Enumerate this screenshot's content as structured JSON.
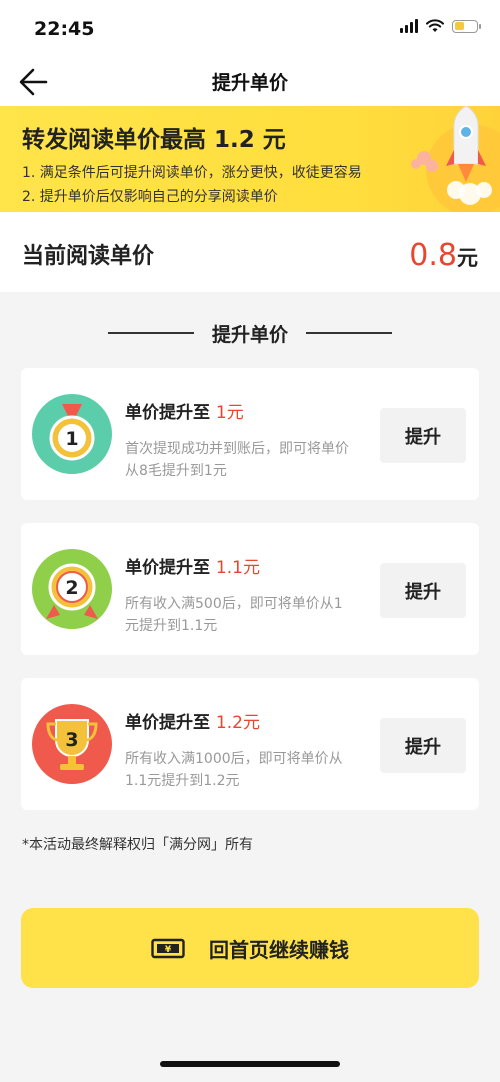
{
  "status_bar": {
    "time": "22:45"
  },
  "nav": {
    "title": "提升单价"
  },
  "banner": {
    "title": "转发阅读单价最高 1.2 元",
    "line1": "1. 满足条件后可提升阅读单价，涨分更快，收徒更容易",
    "line2": "2. 提升单价后仅影响自己的分享阅读单价"
  },
  "current_rate": {
    "label": "当前阅读单价",
    "value": "0.8",
    "unit": "元"
  },
  "section": {
    "title": "提升单价"
  },
  "tiers": [
    {
      "title_prefix": "单价提升至 ",
      "amount": "1元",
      "desc": "首次提现成功并到账后，即可将单价从8毛提升到1元",
      "button": "提升",
      "badge_number": "1",
      "badge_color": "#5ccdaa"
    },
    {
      "title_prefix": "单价提升至 ",
      "amount": "1.1元",
      "desc": "所有收入满500后，即可将单价从1元提升到1.1元",
      "button": "提升",
      "badge_number": "2",
      "badge_color": "#8fcf4a"
    },
    {
      "title_prefix": "单价提升至 ",
      "amount": "1.2元",
      "desc": "所有收入满1000后，即可将单价从1.1元提升到1.2元",
      "button": "提升",
      "badge_number": "3",
      "badge_color": "#ef5a4c"
    }
  ],
  "footnote": "*本活动最终解释权归「满分网」所有",
  "home_button": {
    "label": "回首页继续赚钱"
  },
  "colors": {
    "accent": "#e8462d",
    "banner_yellow": "#ffe14a"
  }
}
